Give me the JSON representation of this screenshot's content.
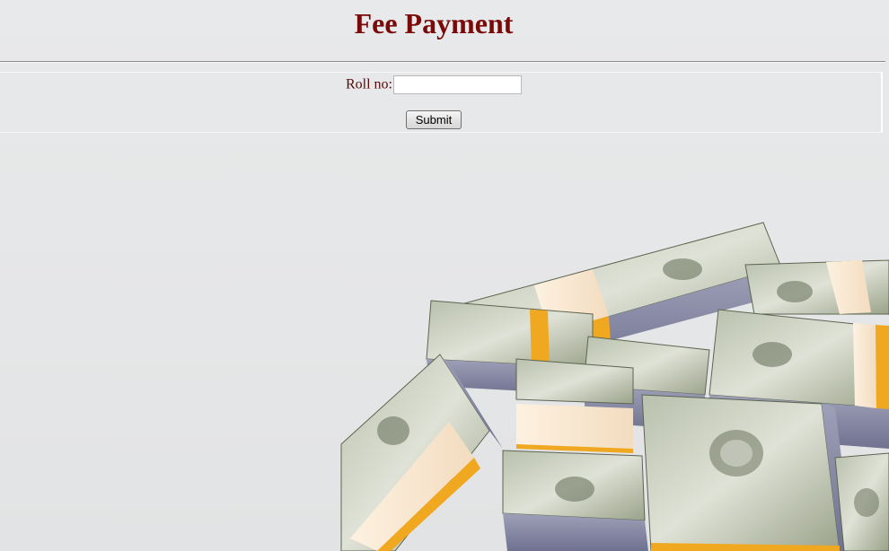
{
  "page": {
    "title": "Fee Payment"
  },
  "form": {
    "roll_label": "Roll no:",
    "roll_value": "",
    "submit_label": "Submit"
  },
  "background": {
    "image": "money-stacks-image",
    "colors": {
      "title": "#7a0a0a",
      "label": "#5a0a0a",
      "bill_green": "#7f8a6e",
      "band_cream": "#f8e6cf",
      "band_orange": "#f0a820"
    }
  }
}
